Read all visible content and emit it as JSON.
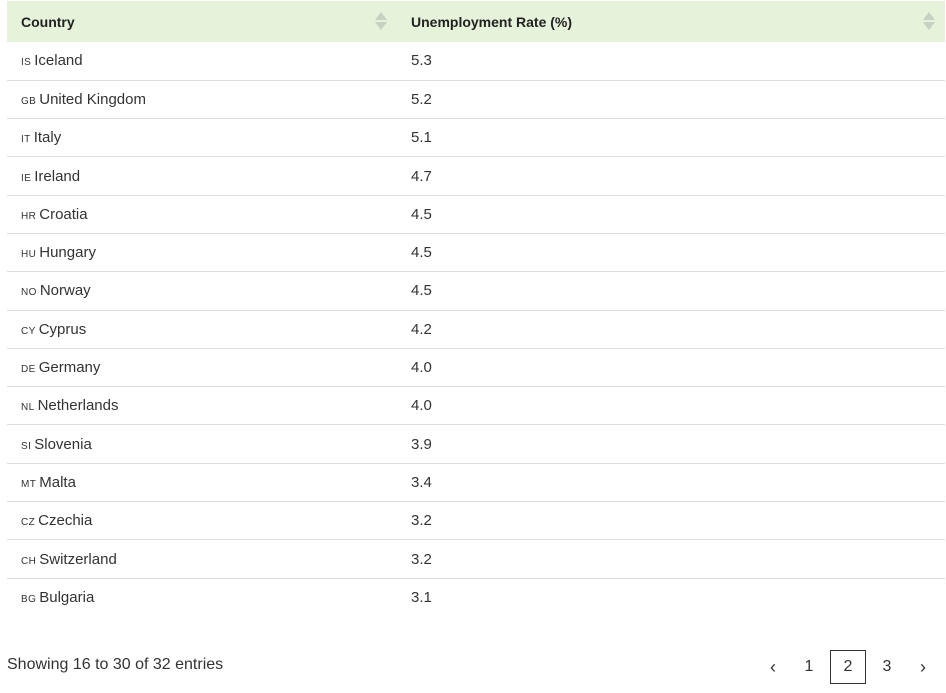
{
  "table": {
    "headers": {
      "country": "Country",
      "rate": "Unemployment Rate (%)"
    },
    "rows": [
      {
        "code": "IS",
        "country": "Iceland",
        "rate": "5.3"
      },
      {
        "code": "GB",
        "country": "United Kingdom",
        "rate": "5.2"
      },
      {
        "code": "IT",
        "country": "Italy",
        "rate": "5.1"
      },
      {
        "code": "IE",
        "country": "Ireland",
        "rate": "4.7"
      },
      {
        "code": "HR",
        "country": "Croatia",
        "rate": "4.5"
      },
      {
        "code": "HU",
        "country": "Hungary",
        "rate": "4.5"
      },
      {
        "code": "NO",
        "country": "Norway",
        "rate": "4.5"
      },
      {
        "code": "CY",
        "country": "Cyprus",
        "rate": "4.2"
      },
      {
        "code": "DE",
        "country": "Germany",
        "rate": "4.0"
      },
      {
        "code": "NL",
        "country": "Netherlands",
        "rate": "4.0"
      },
      {
        "code": "SI",
        "country": "Slovenia",
        "rate": "3.9"
      },
      {
        "code": "MT",
        "country": "Malta",
        "rate": "3.4"
      },
      {
        "code": "CZ",
        "country": "Czechia",
        "rate": "3.2"
      },
      {
        "code": "CH",
        "country": "Switzerland",
        "rate": "3.2"
      },
      {
        "code": "BG",
        "country": "Bulgaria",
        "rate": "3.1"
      }
    ]
  },
  "footer": {
    "info": "Showing 16 to 30 of 32 entries"
  },
  "pagination": {
    "prev": "‹",
    "pages": [
      "1",
      "2",
      "3"
    ],
    "next": "›",
    "current_page": 2
  },
  "colors": {
    "header_bg": "#e6f2da",
    "row_border": "#dedede",
    "sort_arrow": "#c8d0c2"
  }
}
